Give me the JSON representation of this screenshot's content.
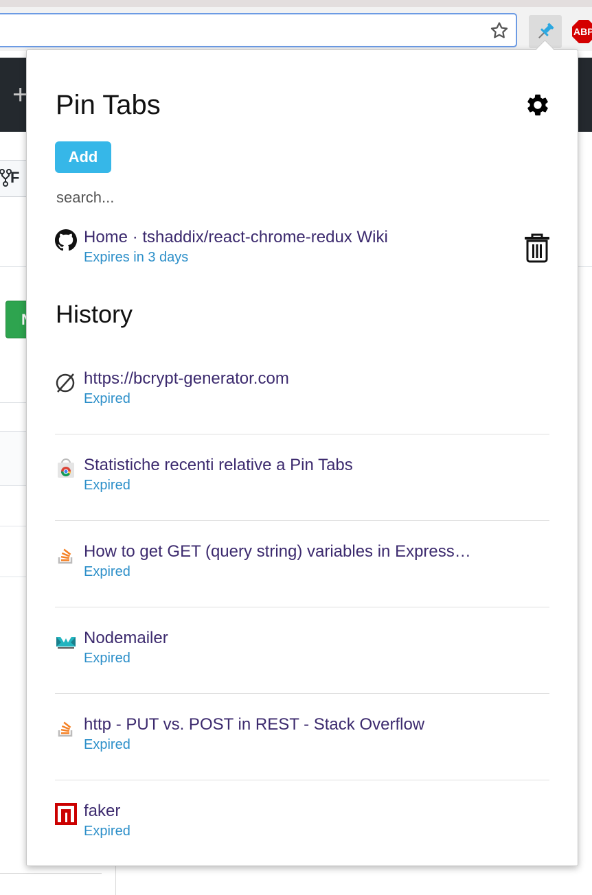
{
  "popup": {
    "title": "Pin Tabs",
    "add_label": "Add",
    "search_placeholder": "search...",
    "pinned": [
      {
        "title": "Home · tshaddix/react-chrome-redux Wiki",
        "status": "Expires in 3 days",
        "icon": "github-icon"
      }
    ],
    "history_heading": "History",
    "history": [
      {
        "title": "https://bcrypt-generator.com",
        "status": "Expired",
        "icon": "no-favicon-icon"
      },
      {
        "title": "Statistiche recenti relative a Pin Tabs",
        "status": "Expired",
        "icon": "chrome-webstore-icon"
      },
      {
        "title": "How to get GET (query string) variables in Express…",
        "status": "Expired",
        "icon": "stackoverflow-icon"
      },
      {
        "title": "Nodemailer",
        "status": "Expired",
        "icon": "nodemailer-icon"
      },
      {
        "title": "http - PUT vs. POST in REST - Stack Overflow",
        "status": "Expired",
        "icon": "stackoverflow-icon"
      },
      {
        "title": "faker",
        "status": "Expired",
        "icon": "npm-icon"
      }
    ]
  },
  "browser": {
    "abp_label": "ABP",
    "extension_icon": "pushpin-icon"
  },
  "background": {
    "plus": "+",
    "fork_label": "F",
    "green_label": "N"
  },
  "colors": {
    "accent": "#36b7e8",
    "link": "#3c2a6e",
    "status": "#2c8fc9"
  }
}
